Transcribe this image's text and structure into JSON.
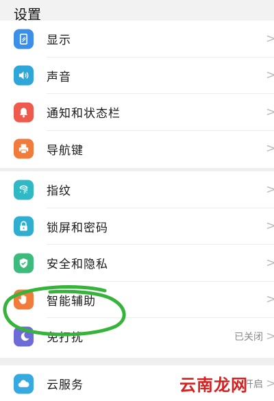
{
  "header": {
    "title": "设置"
  },
  "groups": [
    {
      "items": [
        {
          "label": "显示",
          "icon": "display-icon",
          "color": "#3b8fe8"
        },
        {
          "label": "声音",
          "icon": "speaker-icon",
          "color": "#2fa6d8"
        },
        {
          "label": "通知和状态栏",
          "icon": "bell-icon",
          "color": "#ee5a4c"
        },
        {
          "label": "导航键",
          "icon": "navigation-key-icon",
          "color": "#f07b3a"
        }
      ]
    },
    {
      "items": [
        {
          "label": "指纹",
          "icon": "fingerprint-icon",
          "color": "#30b8c4"
        },
        {
          "label": "锁屏和密码",
          "icon": "lock-icon",
          "color": "#2faed0"
        },
        {
          "label": "安全和隐私",
          "icon": "shield-check-icon",
          "color": "#3dbb7c"
        },
        {
          "label": "智能辅助",
          "icon": "hand-icon",
          "color": "#f07b3a"
        },
        {
          "label": "免打扰",
          "icon": "moon-icon",
          "color": "#6d6bd6",
          "status": "已关闭"
        }
      ]
    },
    {
      "items": [
        {
          "label": "云服务",
          "icon": "cloud-icon",
          "color": "#35a9e0",
          "status": "开启"
        }
      ]
    }
  ],
  "chevron": ">",
  "watermark": "云南龙网",
  "highlight_color": "#36b33a"
}
